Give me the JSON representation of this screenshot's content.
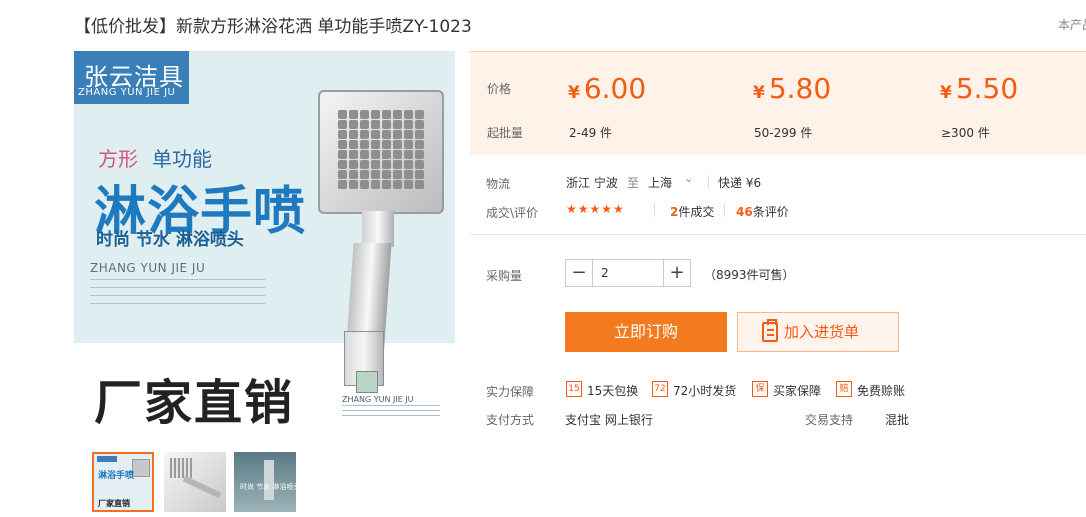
{
  "title": "【低价批发】新款方形淋浴花洒 单功能手喷ZY-1023",
  "corner_text": "本产品",
  "image": {
    "brand_cn": "张云洁具",
    "brand_en": "ZHANG YUN JIE JU",
    "tag1": "方形",
    "tag2": "单功能",
    "big_text": "淋浴手喷",
    "sub_text": "时尚 节水 淋浴喷头",
    "en_line": "ZHANG YUN JIE JU",
    "bottom_text": "厂家直销",
    "head_en": "ZHANG YUN JIE JU"
  },
  "thumbnails": [
    {
      "line1": "淋浴手喷",
      "line2": "厂家直销"
    },
    {},
    {
      "caption": "时尚 节水 淋浴喷头"
    }
  ],
  "price": {
    "price_label": "价格",
    "moq_label": "起批量",
    "currency": "¥",
    "tiers": [
      {
        "price": "6.00",
        "range": "2-49 件"
      },
      {
        "price": "5.80",
        "range": "50-299 件"
      },
      {
        "price": "5.50",
        "range": "≥300 件"
      }
    ]
  },
  "logistics": {
    "label": "物流",
    "from": "浙江 宁波",
    "to_word": "至",
    "to": "上海",
    "express": "快递 ¥6"
  },
  "deals": {
    "label": "成交\\评价",
    "stars": "★★★★★",
    "deals_num": "2",
    "deals_text": "件成交",
    "reviews_num": "46",
    "reviews_text": "条评价"
  },
  "purchase": {
    "label": "采购量",
    "minus": "−",
    "plus": "+",
    "qty": "2",
    "available": "（8993件可售）"
  },
  "buttons": {
    "buy": "立即订购",
    "cart": "加入进货单"
  },
  "guarantee": {
    "label": "实力保障",
    "items": [
      {
        "icon": "15",
        "text": "15天包换"
      },
      {
        "icon": "72",
        "text": "72小时发货"
      },
      {
        "icon": "保",
        "text": "买家保障"
      },
      {
        "icon": "赔",
        "text": "免费赊账"
      }
    ]
  },
  "payment": {
    "label": "支付方式",
    "methods": "支付宝   网上银行",
    "trade_label": "交易支持",
    "trade_value": "混批"
  },
  "colors": {
    "accent": "#f35c12",
    "button": "#f47a20",
    "price_bg": "#fef2e9"
  }
}
